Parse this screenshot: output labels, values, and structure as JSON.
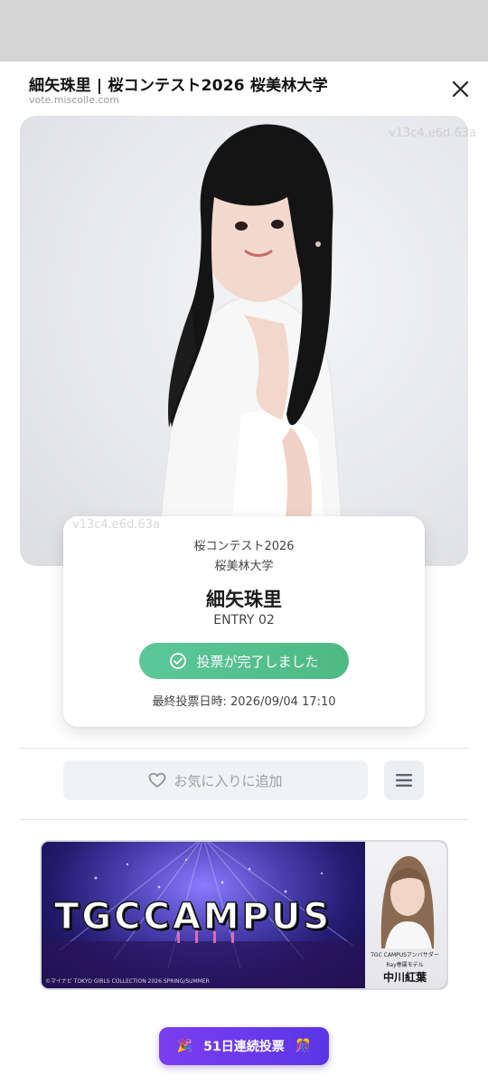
{
  "header": {
    "title": "細矢珠里 | 桜コンテスト2026 桜美林大学",
    "url": "vote.miscolle.com",
    "close_icon": "close-icon"
  },
  "photo": {
    "watermark": "v13c4.e6d.63a"
  },
  "entry_card": {
    "contest": "桜コンテスト2026",
    "university": "桜美林大学",
    "name": "細矢珠里",
    "entry_number": "ENTRY 02",
    "vote_status_label": "投票が完了しました",
    "last_vote": "最終投票日時: 2026/09/04 17:10"
  },
  "actions": {
    "favorite_label": "お気に入りに追加",
    "favorite_icon": "heart-icon",
    "menu_icon": "hamburger-menu-icon"
  },
  "banner": {
    "logo_text": "TGCCAMPUS",
    "credit": "©マイナビ TOKYO GIRLS COLLECTION 2026 SPRING/SUMMER",
    "ambassador_label": "TGC CAMPUSアンバサダー",
    "ambassador_model": "Ray専属モデル",
    "ambassador_name": "中川紅葉"
  },
  "streak": {
    "label": "51日連続投票"
  },
  "colors": {
    "vote_green": "#5cc798",
    "streak_purple": "#6a3aeb"
  }
}
